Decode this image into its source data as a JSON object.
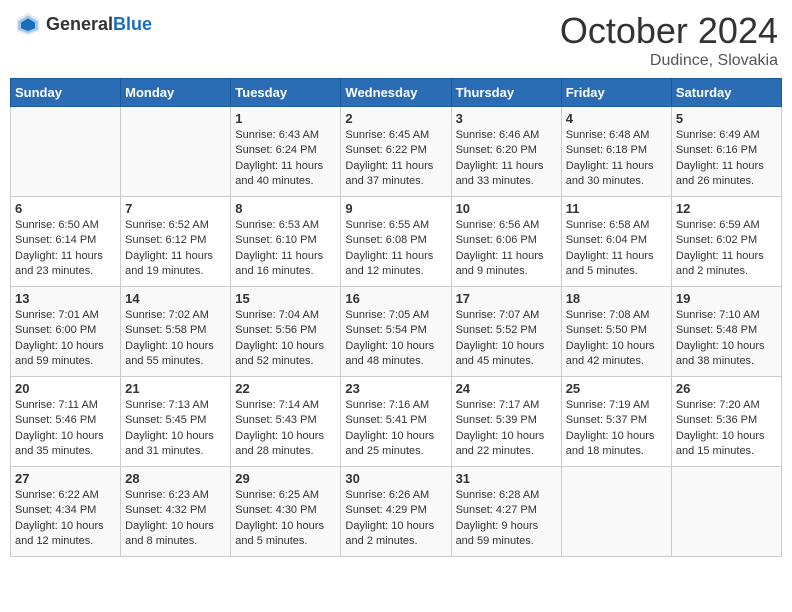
{
  "header": {
    "logo_general": "General",
    "logo_blue": "Blue",
    "month": "October 2024",
    "location": "Dudince, Slovakia"
  },
  "weekdays": [
    "Sunday",
    "Monday",
    "Tuesday",
    "Wednesday",
    "Thursday",
    "Friday",
    "Saturday"
  ],
  "weeks": [
    [
      {
        "day": "",
        "sunrise": "",
        "sunset": "",
        "daylight": ""
      },
      {
        "day": "",
        "sunrise": "",
        "sunset": "",
        "daylight": ""
      },
      {
        "day": "1",
        "sunrise": "Sunrise: 6:43 AM",
        "sunset": "Sunset: 6:24 PM",
        "daylight": "Daylight: 11 hours and 40 minutes."
      },
      {
        "day": "2",
        "sunrise": "Sunrise: 6:45 AM",
        "sunset": "Sunset: 6:22 PM",
        "daylight": "Daylight: 11 hours and 37 minutes."
      },
      {
        "day": "3",
        "sunrise": "Sunrise: 6:46 AM",
        "sunset": "Sunset: 6:20 PM",
        "daylight": "Daylight: 11 hours and 33 minutes."
      },
      {
        "day": "4",
        "sunrise": "Sunrise: 6:48 AM",
        "sunset": "Sunset: 6:18 PM",
        "daylight": "Daylight: 11 hours and 30 minutes."
      },
      {
        "day": "5",
        "sunrise": "Sunrise: 6:49 AM",
        "sunset": "Sunset: 6:16 PM",
        "daylight": "Daylight: 11 hours and 26 minutes."
      }
    ],
    [
      {
        "day": "6",
        "sunrise": "Sunrise: 6:50 AM",
        "sunset": "Sunset: 6:14 PM",
        "daylight": "Daylight: 11 hours and 23 minutes."
      },
      {
        "day": "7",
        "sunrise": "Sunrise: 6:52 AM",
        "sunset": "Sunset: 6:12 PM",
        "daylight": "Daylight: 11 hours and 19 minutes."
      },
      {
        "day": "8",
        "sunrise": "Sunrise: 6:53 AM",
        "sunset": "Sunset: 6:10 PM",
        "daylight": "Daylight: 11 hours and 16 minutes."
      },
      {
        "day": "9",
        "sunrise": "Sunrise: 6:55 AM",
        "sunset": "Sunset: 6:08 PM",
        "daylight": "Daylight: 11 hours and 12 minutes."
      },
      {
        "day": "10",
        "sunrise": "Sunrise: 6:56 AM",
        "sunset": "Sunset: 6:06 PM",
        "daylight": "Daylight: 11 hours and 9 minutes."
      },
      {
        "day": "11",
        "sunrise": "Sunrise: 6:58 AM",
        "sunset": "Sunset: 6:04 PM",
        "daylight": "Daylight: 11 hours and 5 minutes."
      },
      {
        "day": "12",
        "sunrise": "Sunrise: 6:59 AM",
        "sunset": "Sunset: 6:02 PM",
        "daylight": "Daylight: 11 hours and 2 minutes."
      }
    ],
    [
      {
        "day": "13",
        "sunrise": "Sunrise: 7:01 AM",
        "sunset": "Sunset: 6:00 PM",
        "daylight": "Daylight: 10 hours and 59 minutes."
      },
      {
        "day": "14",
        "sunrise": "Sunrise: 7:02 AM",
        "sunset": "Sunset: 5:58 PM",
        "daylight": "Daylight: 10 hours and 55 minutes."
      },
      {
        "day": "15",
        "sunrise": "Sunrise: 7:04 AM",
        "sunset": "Sunset: 5:56 PM",
        "daylight": "Daylight: 10 hours and 52 minutes."
      },
      {
        "day": "16",
        "sunrise": "Sunrise: 7:05 AM",
        "sunset": "Sunset: 5:54 PM",
        "daylight": "Daylight: 10 hours and 48 minutes."
      },
      {
        "day": "17",
        "sunrise": "Sunrise: 7:07 AM",
        "sunset": "Sunset: 5:52 PM",
        "daylight": "Daylight: 10 hours and 45 minutes."
      },
      {
        "day": "18",
        "sunrise": "Sunrise: 7:08 AM",
        "sunset": "Sunset: 5:50 PM",
        "daylight": "Daylight: 10 hours and 42 minutes."
      },
      {
        "day": "19",
        "sunrise": "Sunrise: 7:10 AM",
        "sunset": "Sunset: 5:48 PM",
        "daylight": "Daylight: 10 hours and 38 minutes."
      }
    ],
    [
      {
        "day": "20",
        "sunrise": "Sunrise: 7:11 AM",
        "sunset": "Sunset: 5:46 PM",
        "daylight": "Daylight: 10 hours and 35 minutes."
      },
      {
        "day": "21",
        "sunrise": "Sunrise: 7:13 AM",
        "sunset": "Sunset: 5:45 PM",
        "daylight": "Daylight: 10 hours and 31 minutes."
      },
      {
        "day": "22",
        "sunrise": "Sunrise: 7:14 AM",
        "sunset": "Sunset: 5:43 PM",
        "daylight": "Daylight: 10 hours and 28 minutes."
      },
      {
        "day": "23",
        "sunrise": "Sunrise: 7:16 AM",
        "sunset": "Sunset: 5:41 PM",
        "daylight": "Daylight: 10 hours and 25 minutes."
      },
      {
        "day": "24",
        "sunrise": "Sunrise: 7:17 AM",
        "sunset": "Sunset: 5:39 PM",
        "daylight": "Daylight: 10 hours and 22 minutes."
      },
      {
        "day": "25",
        "sunrise": "Sunrise: 7:19 AM",
        "sunset": "Sunset: 5:37 PM",
        "daylight": "Daylight: 10 hours and 18 minutes."
      },
      {
        "day": "26",
        "sunrise": "Sunrise: 7:20 AM",
        "sunset": "Sunset: 5:36 PM",
        "daylight": "Daylight: 10 hours and 15 minutes."
      }
    ],
    [
      {
        "day": "27",
        "sunrise": "Sunrise: 6:22 AM",
        "sunset": "Sunset: 4:34 PM",
        "daylight": "Daylight: 10 hours and 12 minutes."
      },
      {
        "day": "28",
        "sunrise": "Sunrise: 6:23 AM",
        "sunset": "Sunset: 4:32 PM",
        "daylight": "Daylight: 10 hours and 8 minutes."
      },
      {
        "day": "29",
        "sunrise": "Sunrise: 6:25 AM",
        "sunset": "Sunset: 4:30 PM",
        "daylight": "Daylight: 10 hours and 5 minutes."
      },
      {
        "day": "30",
        "sunrise": "Sunrise: 6:26 AM",
        "sunset": "Sunset: 4:29 PM",
        "daylight": "Daylight: 10 hours and 2 minutes."
      },
      {
        "day": "31",
        "sunrise": "Sunrise: 6:28 AM",
        "sunset": "Sunset: 4:27 PM",
        "daylight": "Daylight: 9 hours and 59 minutes."
      },
      {
        "day": "",
        "sunrise": "",
        "sunset": "",
        "daylight": ""
      },
      {
        "day": "",
        "sunrise": "",
        "sunset": "",
        "daylight": ""
      }
    ]
  ]
}
